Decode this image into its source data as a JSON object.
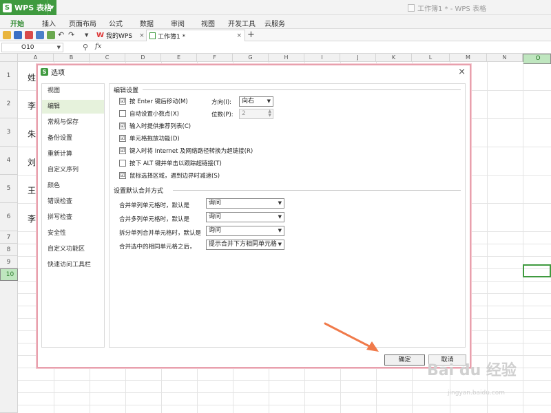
{
  "app": {
    "name": "WPS 表格",
    "doc_title": "工作簿1 * - WPS 表格"
  },
  "ribbon": {
    "tabs": [
      "开始",
      "插入",
      "页面布局",
      "公式",
      "数据",
      "审阅",
      "视图",
      "开发工具",
      "云服务"
    ]
  },
  "doc_tabs": [
    {
      "label": "我的WPS"
    },
    {
      "label": "工作簿1 *"
    }
  ],
  "formula_bar": {
    "cell_ref": "O10",
    "fx": "fx"
  },
  "grid": {
    "columns": [
      "A",
      "B",
      "C",
      "D",
      "E",
      "F",
      "G",
      "H",
      "I",
      "J",
      "K",
      "L",
      "M",
      "N",
      "O"
    ],
    "rows": [
      "1",
      "2",
      "3",
      "4",
      "5",
      "6",
      "7",
      "8",
      "9",
      "10"
    ],
    "cells": [
      "姓",
      "李",
      "朱",
      "刘",
      "王",
      "李"
    ]
  },
  "dialog": {
    "title": "选项",
    "close": "×",
    "sidebar": [
      "视图",
      "编辑",
      "常规与保存",
      "备份设置",
      "重新计算",
      "自定义序列",
      "颜色",
      "错误检查",
      "拼写检查",
      "安全性",
      "自定义功能区",
      "快速访问工具栏"
    ],
    "edit_section": {
      "title": "编辑设置",
      "checkboxes": [
        {
          "label": "按 Enter 键后移动(M)",
          "checked": "☑"
        },
        {
          "label": "自动设置小数点(X)",
          "checked": ""
        },
        {
          "label": "输入时提供推荐列表(C)",
          "checked": "☑"
        },
        {
          "label": "单元格拖放功能(D)",
          "checked": "☑"
        },
        {
          "label": "键入时将 Internet 及网络路径转换为超链接(R)",
          "checked": "☑"
        },
        {
          "label": "按下 ALT 键并单击以跟踪超链接(T)",
          "checked": ""
        },
        {
          "label": "鼠标选择区域，遇到边界时减速(S)",
          "checked": "☑"
        }
      ],
      "direction_label": "方向(I):",
      "direction_value": "向右",
      "digits_label": "位数(P):",
      "digits_value": "2"
    },
    "merge_section": {
      "title": "设置默认合并方式",
      "rows": [
        {
          "label": "合并单列单元格时，默认是",
          "value": "询问"
        },
        {
          "label": "合并多列单元格时，默认是",
          "value": "询问"
        },
        {
          "label": "拆分单列合并单元格时，默认是",
          "value": "询问"
        },
        {
          "label": "合并选中的相同单元格之后，",
          "value": "提示合并下方相同单元格"
        }
      ]
    },
    "ok_label": "确定",
    "cancel_label": "取消"
  },
  "watermark": {
    "brand": "Bai du 经验",
    "url": "jingyan.baidu.com"
  },
  "colors": {
    "accent": "#3f9a3f",
    "dialog_border": "#e8a0ad",
    "arrow": "#f07a4a"
  }
}
